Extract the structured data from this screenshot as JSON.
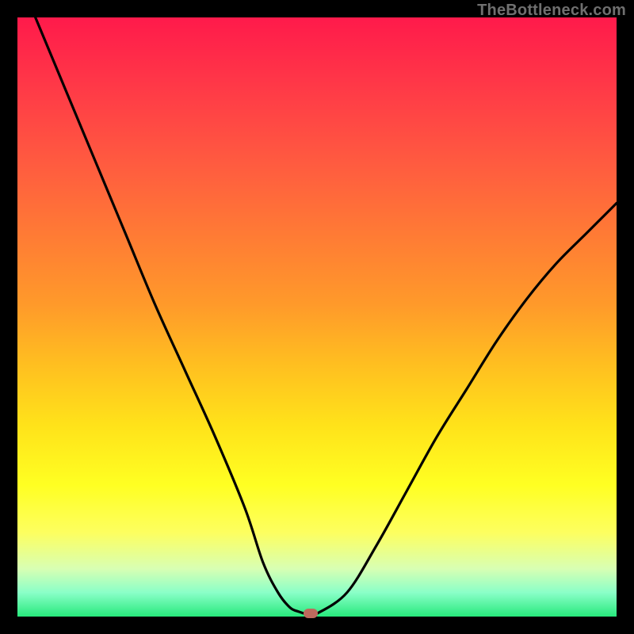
{
  "watermark": "TheBottleneck.com",
  "chart_data": {
    "type": "line",
    "title": "",
    "xlabel": "",
    "ylabel": "",
    "xlim": [
      0,
      100
    ],
    "ylim": [
      0,
      100
    ],
    "x": [
      3,
      8,
      13,
      18,
      23,
      28,
      33,
      38,
      41,
      43.5,
      45.5,
      47,
      48,
      49,
      50,
      55,
      60,
      65,
      70,
      75,
      80,
      85,
      90,
      95,
      100
    ],
    "values": [
      100,
      88,
      76,
      64,
      52,
      41,
      30,
      18,
      9,
      4,
      1.5,
      0.8,
      0.5,
      0.5,
      0.5,
      4,
      12,
      21,
      30,
      38,
      46,
      53,
      59,
      64,
      69
    ],
    "grid": false,
    "marker": {
      "x": 49,
      "y": 0.5
    }
  },
  "colors": {
    "curve": "#000000",
    "marker": "#bd6a5d",
    "gradient_top": "#ff1a4b",
    "gradient_bottom": "#27e97c"
  }
}
